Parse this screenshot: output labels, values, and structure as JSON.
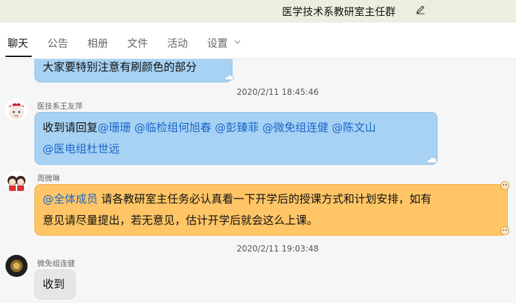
{
  "window": {
    "title": "医学技术系教研室主任群"
  },
  "tabs": [
    {
      "label": "聊天",
      "active": true
    },
    {
      "label": "公告"
    },
    {
      "label": "相册"
    },
    {
      "label": "文件"
    },
    {
      "label": "活动"
    },
    {
      "label": "设置"
    }
  ],
  "messages": [
    {
      "text": "大家要特别注意有刷颜色的部分"
    },
    {
      "timestamp": "2020/2/11 18:45:46"
    },
    {
      "sender": "医技系王友萍",
      "prefix": "收到请回复",
      "mentions": "@珊珊 @临检组何旭春 @彭臻菲 @微免组连健 @陈文山",
      "line2": "@医电组杜世远"
    },
    {
      "sender": "周微琳",
      "mention": "@全体成员",
      "text1": " 请各教研室主任务必认真看一下开学后的授课方式和计划安排，如有",
      "text2": "意见请尽量提出，若无意见，估计开学后就会这么上课。"
    },
    {
      "timestamp": "2020/2/11 19:03:48"
    },
    {
      "sender": "微免组连健",
      "text": "收到"
    }
  ],
  "colors": {
    "blue_bubble": "#a7d2f4",
    "orange_bubble": "#ffc566",
    "gray_bubble": "#e6e6e6",
    "mention": "#1a66c9"
  }
}
